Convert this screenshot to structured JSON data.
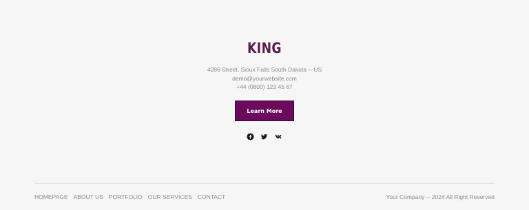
{
  "brand": {
    "name": "KING"
  },
  "contact": {
    "address": "4286 Street, Sioux Falls South Dakota -- US",
    "email": "demo@yourwebsite.com",
    "phone": "+44 (0800) 123 45 67"
  },
  "cta": {
    "label": "Learn More"
  },
  "socials": [
    {
      "icon": "facebook-icon"
    },
    {
      "icon": "twitter-icon"
    },
    {
      "icon": "vk-icon"
    }
  ],
  "footer": {
    "nav": [
      "HOMEPAGE",
      "ABOUT US",
      "PORTFOLIO",
      "OUR SERVICES",
      "CONTACT"
    ],
    "copyright": "Your Company -- 2024 All Right Reserved"
  },
  "colors": {
    "accent": "#6b0a5d",
    "brand": "#5b1a4a",
    "background": "#f6f6f6"
  }
}
